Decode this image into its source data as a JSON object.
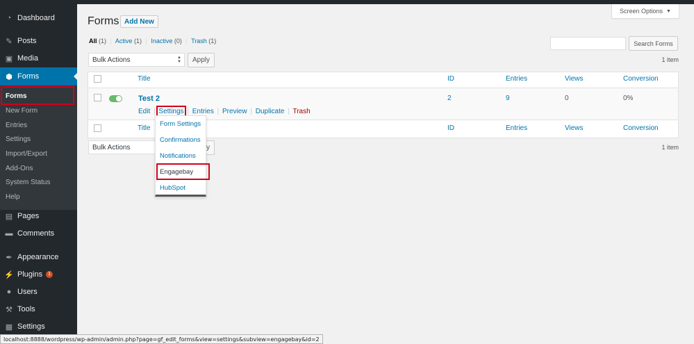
{
  "sidebar": {
    "items": [
      {
        "key": "dashboard",
        "label": "Dashboard",
        "icon": "dashboard-icon",
        "glyph": "◔"
      },
      {
        "key": "posts",
        "label": "Posts",
        "icon": "pin-icon",
        "glyph": "✎"
      },
      {
        "key": "media",
        "label": "Media",
        "icon": "media-icon",
        "glyph": "▣"
      },
      {
        "key": "forms",
        "label": "Forms",
        "icon": "gravity-forms-icon",
        "glyph": "⬢"
      },
      {
        "key": "pages",
        "label": "Pages",
        "icon": "pages-icon",
        "glyph": "▤"
      },
      {
        "key": "comments",
        "label": "Comments",
        "icon": "comments-icon",
        "glyph": "▬"
      },
      {
        "key": "appearance",
        "label": "Appearance",
        "icon": "brush-icon",
        "glyph": "✒"
      },
      {
        "key": "plugins",
        "label": "Plugins",
        "icon": "plugin-icon",
        "glyph": "⚡",
        "badge": "1"
      },
      {
        "key": "users",
        "label": "Users",
        "icon": "user-icon",
        "glyph": "●"
      },
      {
        "key": "tools",
        "label": "Tools",
        "icon": "wrench-icon",
        "glyph": "⚒"
      },
      {
        "key": "settings",
        "label": "Settings",
        "icon": "settings-icon",
        "glyph": "▦"
      }
    ],
    "submenu": [
      "Forms",
      "New Form",
      "Entries",
      "Settings",
      "Import/Export",
      "Add-Ons",
      "System Status",
      "Help"
    ]
  },
  "header": {
    "title": "Forms",
    "add_new": "Add New",
    "screen_options": "Screen Options"
  },
  "filters": {
    "all": "All",
    "all_count": "(1)",
    "active": "Active",
    "active_count": "(1)",
    "inactive": "Inactive",
    "inactive_count": "(0)",
    "trash": "Trash",
    "trash_count": "(1)",
    "separator": "|"
  },
  "search": {
    "button": "Search Forms",
    "value": ""
  },
  "bulk": {
    "label": "Bulk Actions",
    "apply": "Apply",
    "items_count": "1 item"
  },
  "table": {
    "columns": {
      "title": "Title",
      "id": "ID",
      "entries": "Entries",
      "views": "Views",
      "conversion": "Conversion"
    },
    "row": {
      "title": "Test 2",
      "id": "2",
      "entries": "9",
      "views": "0",
      "conversion": "0%",
      "active": true,
      "actions": {
        "edit": "Edit",
        "settings": "Settings",
        "entries": "Entries",
        "preview": "Preview",
        "duplicate": "Duplicate",
        "trash": "Trash"
      },
      "sep": "|"
    }
  },
  "settings_dropdown": [
    "Form Settings",
    "Confirmations",
    "Notifications",
    "Engagebay",
    "HubSpot"
  ],
  "status_url": "localhost:8888/wordpress/wp-admin/admin.php?page=gf_edit_forms&view=settings&subview=engagebay&id=2",
  "colors": {
    "sidebar": "#23282d",
    "accent": "#0073aa",
    "highlight": "#d0021b",
    "toggle_on": "#66bb6a"
  }
}
